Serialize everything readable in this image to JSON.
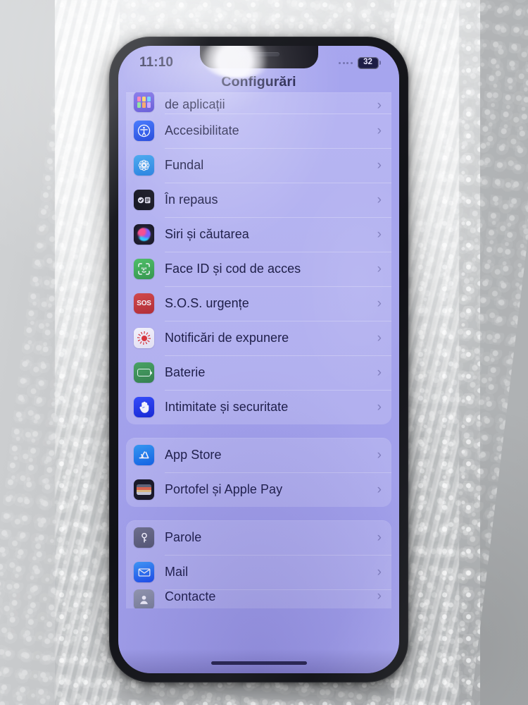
{
  "device": {
    "notch_icon": "notch-speaker",
    "home_indicator_icon": "home-indicator"
  },
  "status_bar": {
    "time": "11:10",
    "signal_icon": "signal-dots-icon",
    "battery_percent": "32",
    "battery_icon": "battery-icon"
  },
  "nav": {
    "title": "Configurări"
  },
  "groups": [
    {
      "clipped_top": true,
      "rows": [
        {
          "label": "de aplicații",
          "icon": "app-library-icon",
          "icon_class": "ic-applib",
          "chevron": "›",
          "partial_top": true
        },
        {
          "label": "Accesibilitate",
          "icon": "accessibility-icon",
          "icon_class": "ic-access",
          "chevron": "›"
        },
        {
          "label": "Fundal",
          "icon": "wallpaper-icon",
          "icon_class": "ic-wallpaper",
          "chevron": "›"
        },
        {
          "label": "În repaus",
          "icon": "standby-icon",
          "icon_class": "ic-standby",
          "chevron": "›"
        },
        {
          "label": "Siri și căutarea",
          "icon": "siri-icon",
          "icon_class": "ic-siri",
          "chevron": "›"
        },
        {
          "label": "Face ID și cod de acces",
          "icon": "face-id-icon",
          "icon_class": "ic-faceid",
          "chevron": "›"
        },
        {
          "label": "S.O.S. urgențe",
          "icon": "sos-icon",
          "icon_class": "ic-sos",
          "chevron": "›"
        },
        {
          "label": "Notificări de expunere",
          "icon": "exposure-notifications-icon",
          "icon_class": "ic-expo",
          "chevron": "›"
        },
        {
          "label": "Baterie",
          "icon": "battery-settings-icon",
          "icon_class": "ic-battery",
          "chevron": "›"
        },
        {
          "label": "Intimitate și securitate",
          "icon": "privacy-icon",
          "icon_class": "ic-privacy",
          "chevron": "›"
        }
      ]
    },
    {
      "rows": [
        {
          "label": "App Store",
          "icon": "app-store-icon",
          "icon_class": "ic-appstore",
          "chevron": "›"
        },
        {
          "label": "Portofel și Apple Pay",
          "icon": "wallet-icon",
          "icon_class": "ic-wallet",
          "chevron": "›"
        }
      ]
    },
    {
      "clipped_bottom": true,
      "rows": [
        {
          "label": "Parole",
          "icon": "passwords-icon",
          "icon_class": "ic-passwords",
          "chevron": "›"
        },
        {
          "label": "Mail",
          "icon": "mail-icon",
          "icon_class": "ic-mail",
          "chevron": "›"
        },
        {
          "label": "Contacte",
          "icon": "contacts-icon",
          "icon_class": "ic-contacts",
          "chevron": "›",
          "partial": true
        }
      ]
    }
  ],
  "colors": {
    "screen_background": "#9a9aea",
    "card_background": "#a8a9f0",
    "label_text": "#16173c",
    "chevron": "#6461a8",
    "phone_frame": "#15161b",
    "backdrop": "#c3c5c7"
  }
}
